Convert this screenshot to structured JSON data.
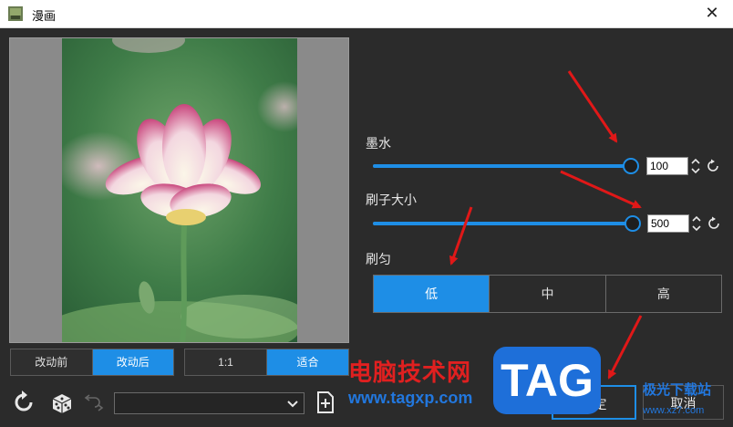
{
  "window": {
    "title": "漫画"
  },
  "preview_toggle": {
    "before": "改动前",
    "after": "改动后",
    "active": "after"
  },
  "zoom_toggle": {
    "one_to_one": "1:1",
    "fit": "适合",
    "active": "fit"
  },
  "toolbar": {
    "preset_value": ""
  },
  "ink": {
    "label": "墨水",
    "value": "100",
    "fraction": 1.0
  },
  "brush_size": {
    "label": "刷子大小",
    "value": "500",
    "fraction": 1.0
  },
  "uniformity": {
    "label": "刷匀",
    "options": [
      "低",
      "中",
      "高"
    ],
    "active_index": 0
  },
  "actions": {
    "ok": "确定",
    "cancel": "取消"
  },
  "watermark": {
    "site_cn": "电脑技术网",
    "url": "www.tagxp.com",
    "logo": "TAG",
    "side_text": "极光下载站",
    "side_url": "www.xz7.com"
  },
  "colors": {
    "accent": "#1e8ee6",
    "panel": "#2b2b2b",
    "arrow": "#e01818"
  }
}
